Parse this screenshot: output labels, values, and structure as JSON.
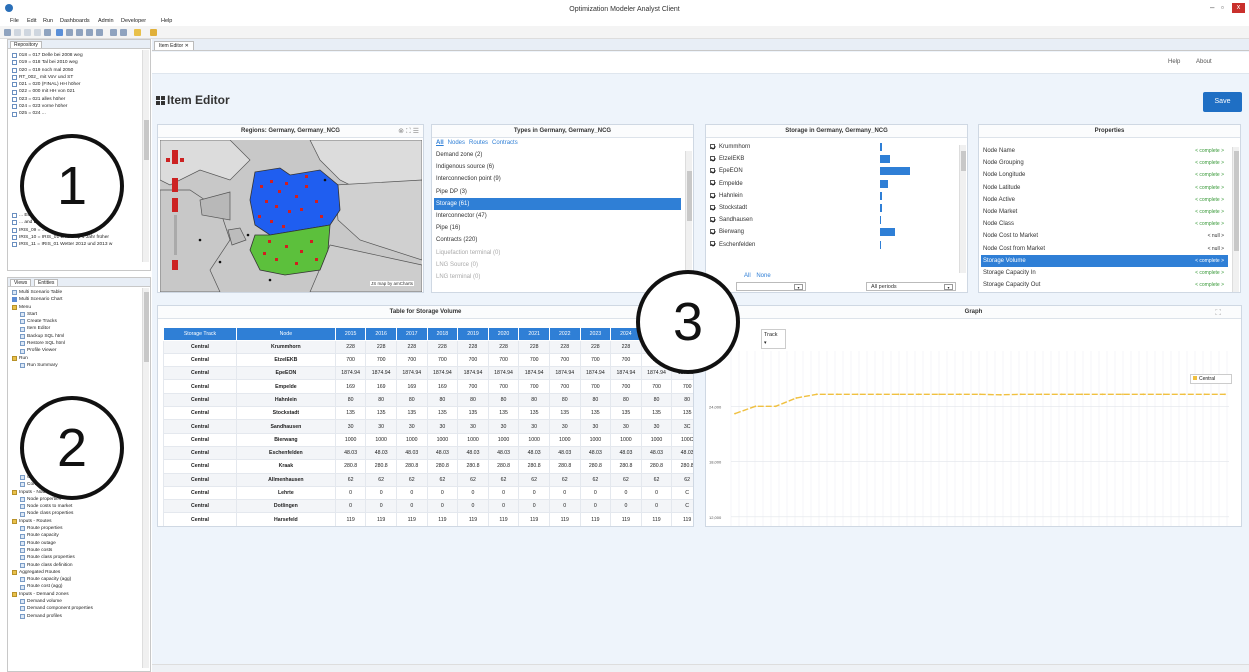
{
  "window": {
    "title": "Optimization Modeler Analyst Client",
    "minimize": "–",
    "restore": "▫",
    "close": "x"
  },
  "menu": [
    "File",
    "Edit",
    "Run",
    "Dashboards",
    "Admin",
    "Developer",
    "Help"
  ],
  "repository": {
    "tab_label": "Repository",
    "items": [
      "018 = 017 Delle bei 2008 weg",
      "019 = 018 Tal bei 2010 weg",
      "020 = 019 noch mal 2050",
      "RT_002_ mit VoV und ST",
      "021 = 020 (FINAL) HH höher",
      "022 = 000 mit HH von 021",
      "023 = 021 alles höher",
      "024 = 023 vorne höher",
      "025 = 024 ..."
    ],
    "items_lower": [
      "... Europ",
      "... and Europ",
      "IRIS_09 = ... Cap 1 Jahr später",
      "IRIS_10 = IRIS_01 LNG Cap 1 Jahr früher",
      "IRIS_11 = IRIS_01 Wetter 2012 und 2013 w"
    ]
  },
  "views": {
    "tab_views": "Views",
    "tab_entities": "Entities",
    "items_top": [
      {
        "label": "Multi Scenario Table",
        "icon": "page"
      },
      {
        "label": "Multi Scenario Chart",
        "icon": "chart"
      },
      {
        "label": "Menu",
        "icon": "folder"
      },
      {
        "label": "Start",
        "icon": "page",
        "indent": 1
      },
      {
        "label": "Create Tracks",
        "icon": "page",
        "indent": 1
      },
      {
        "label": "Item Editor",
        "icon": "page",
        "indent": 1
      },
      {
        "label": "Backup SQL html",
        "icon": "page",
        "indent": 1
      },
      {
        "label": "Restore SQL html",
        "icon": "page",
        "indent": 1
      },
      {
        "label": "Profile Viewer",
        "icon": "page",
        "indent": 1
      },
      {
        "label": "Run",
        "icon": "folder"
      },
      {
        "label": "Run Summary",
        "icon": "page",
        "indent": 1
      }
    ],
    "items_bottom": [
      {
        "label": "Cost ...",
        "icon": "page",
        "indent": 1
      },
      {
        "label": "Contract tracks",
        "icon": "page",
        "indent": 1
      },
      {
        "label": "Inputs - Nodes",
        "icon": "folder"
      },
      {
        "label": "Node properties",
        "icon": "page",
        "indent": 1
      },
      {
        "label": "Node costs to market",
        "icon": "page",
        "indent": 1
      },
      {
        "label": "Node class properties",
        "icon": "page",
        "indent": 1
      },
      {
        "label": "Inputs - Routes",
        "icon": "folder"
      },
      {
        "label": "Route properties",
        "icon": "page",
        "indent": 1
      },
      {
        "label": "Route capacity",
        "icon": "page",
        "indent": 1
      },
      {
        "label": "Route outage",
        "icon": "page",
        "indent": 1
      },
      {
        "label": "Route costs",
        "icon": "page",
        "indent": 1
      },
      {
        "label": "Route class properties",
        "icon": "page",
        "indent": 1
      },
      {
        "label": "Route class definition",
        "icon": "page",
        "indent": 1
      },
      {
        "label": "Aggregated Routes",
        "icon": "folder"
      },
      {
        "label": "Route capacity (agg)",
        "icon": "page",
        "indent": 1
      },
      {
        "label": "Route cost (agg)",
        "icon": "page",
        "indent": 1
      },
      {
        "label": "Inputs - Demand zones",
        "icon": "folder"
      },
      {
        "label": "Demand volume",
        "icon": "page",
        "indent": 1
      },
      {
        "label": "Demand component properties",
        "icon": "page",
        "indent": 1
      },
      {
        "label": "Demand profiles",
        "icon": "page",
        "indent": 1
      }
    ]
  },
  "editor": {
    "tab_label": "Item Editor",
    "help": "Help",
    "about": "About",
    "title": "Item Editor",
    "save": "Save"
  },
  "regions": {
    "title": "Regions: Germany, Germany_NCG",
    "credit": "JS map by amCharts"
  },
  "types": {
    "title": "Types in Germany, Germany_NCG",
    "filters": [
      "All",
      "Nodes",
      "Routes",
      "Contracts"
    ],
    "items": [
      {
        "label": "Demand zone (2)",
        "state": "normal"
      },
      {
        "label": "Indigenous source (6)",
        "state": "normal"
      },
      {
        "label": "Interconnection point (9)",
        "state": "normal"
      },
      {
        "label": "Pipe DP (3)",
        "state": "normal"
      },
      {
        "label": "Storage (61)",
        "state": "selected"
      },
      {
        "label": "Interconnector (47)",
        "state": "normal"
      },
      {
        "label": "Pipe (16)",
        "state": "normal"
      },
      {
        "label": "Contracts (220)",
        "state": "normal"
      },
      {
        "label": "Liquefaction terminal (0)",
        "state": "disabled"
      },
      {
        "label": "LNG Source (0)",
        "state": "disabled"
      },
      {
        "label": "LNG terminal (0)",
        "state": "disabled"
      }
    ]
  },
  "storage": {
    "title": "Storage in Germany, Germany_NCG",
    "items": [
      {
        "label": "Krummhorn",
        "fraction": 0.02
      },
      {
        "label": "EtzelEKB",
        "fraction": 0.13
      },
      {
        "label": "EpeEON",
        "fraction": 0.4
      },
      {
        "label": "Empelde",
        "fraction": 0.1
      },
      {
        "label": "Hahnlein",
        "fraction": 0.02
      },
      {
        "label": "Stockstadt",
        "fraction": 0.02
      },
      {
        "label": "Sandhausen",
        "fraction": 0.01
      },
      {
        "label": "Bierwang",
        "fraction": 0.2
      },
      {
        "label": "Eschenfelden",
        "fraction": 0.01
      }
    ],
    "select_all": "All",
    "select_none": "None",
    "period_select": "All periods"
  },
  "properties": {
    "title": "Properties",
    "items": [
      {
        "label": "Node Name",
        "value": "< complete >"
      },
      {
        "label": "Node Grouping",
        "value": "< complete >"
      },
      {
        "label": "Node Longitude",
        "value": "< complete >"
      },
      {
        "label": "Node Latitude",
        "value": "< complete >"
      },
      {
        "label": "Node Active",
        "value": "< complete >"
      },
      {
        "label": "Node Market",
        "value": "< complete >"
      },
      {
        "label": "Node Class",
        "value": "< complete >"
      },
      {
        "label": "Node Cost to Market",
        "value": "< null >"
      },
      {
        "label": "Node Cost from Market",
        "value": "< null >"
      },
      {
        "label": "Storage Volume",
        "value": "< complete >",
        "selected": true
      },
      {
        "label": "Storage Capacity In",
        "value": "< complete >"
      },
      {
        "label": "Storage Capacity Out",
        "value": "< complete >"
      }
    ]
  },
  "table": {
    "title": "Table for Storage Volume",
    "columns": [
      "Storage Track",
      "Node",
      "2015",
      "2016",
      "2017",
      "2018",
      "2019",
      "2020",
      "2021",
      "2022",
      "2023",
      "2024",
      "2025",
      "20"
    ],
    "rows": [
      [
        "Central",
        "Krummhorn",
        "228",
        "228",
        "228",
        "228",
        "228",
        "228",
        "228",
        "228",
        "228",
        "228",
        "228",
        ""
      ],
      [
        "Central",
        "EtzelEKB",
        "700",
        "700",
        "700",
        "700",
        "700",
        "700",
        "700",
        "700",
        "700",
        "700",
        "700",
        "7"
      ],
      [
        "Central",
        "EpeEON",
        "1874.94",
        "1874.94",
        "1874.94",
        "1874.94",
        "1874.94",
        "1874.94",
        "1874.94",
        "1874.94",
        "1874.94",
        "1874.94",
        "1874.94",
        "1874.94"
      ],
      [
        "Central",
        "Empelde",
        "169",
        "169",
        "169",
        "169",
        "700",
        "700",
        "700",
        "700",
        "700",
        "700",
        "700",
        "700"
      ],
      [
        "Central",
        "Hahnlein",
        "80",
        "80",
        "80",
        "80",
        "80",
        "80",
        "80",
        "80",
        "80",
        "80",
        "80",
        "80"
      ],
      [
        "Central",
        "Stockstadt",
        "135",
        "135",
        "135",
        "135",
        "135",
        "135",
        "135",
        "135",
        "135",
        "135",
        "135",
        "135"
      ],
      [
        "Central",
        "Sandhausen",
        "30",
        "30",
        "30",
        "30",
        "30",
        "30",
        "30",
        "30",
        "30",
        "30",
        "30",
        "3C"
      ],
      [
        "Central",
        "Bierwang",
        "1000",
        "1000",
        "1000",
        "1000",
        "1000",
        "1000",
        "1000",
        "1000",
        "1000",
        "1000",
        "1000",
        "100C"
      ],
      [
        "Central",
        "Eschenfelden",
        "48.03",
        "48.03",
        "48.03",
        "48.03",
        "48.03",
        "48.03",
        "48.03",
        "48.03",
        "48.03",
        "48.03",
        "48.03",
        "48.03"
      ],
      [
        "Central",
        "Kraak",
        "280.8",
        "280.8",
        "280.8",
        "280.8",
        "280.8",
        "280.8",
        "280.8",
        "280.8",
        "280.8",
        "280.8",
        "280.8",
        "280.8"
      ],
      [
        "Central",
        "Allmenhausen",
        "62",
        "62",
        "62",
        "62",
        "62",
        "62",
        "62",
        "62",
        "62",
        "62",
        "62",
        "62"
      ],
      [
        "Central",
        "Lehrte",
        "0",
        "0",
        "0",
        "0",
        "0",
        "0",
        "0",
        "0",
        "0",
        "0",
        "0",
        "C"
      ],
      [
        "Central",
        "Dotlingen",
        "0",
        "0",
        "0",
        "0",
        "0",
        "0",
        "0",
        "0",
        "0",
        "0",
        "0",
        "C"
      ],
      [
        "Central",
        "Harsefeld",
        "119",
        "119",
        "119",
        "119",
        "119",
        "119",
        "119",
        "119",
        "119",
        "119",
        "119",
        "119"
      ]
    ]
  },
  "graph": {
    "title": "Graph",
    "track_label": "Track",
    "legend": "Central",
    "yticks": [
      "24,000",
      "18,000",
      "12,000"
    ]
  },
  "annotations": [
    "1",
    "2",
    "3"
  ],
  "chart_data": {
    "type": "line",
    "title": "Graph",
    "series": [
      {
        "name": "Central",
        "values": [
          23200,
          24000,
          24000,
          24900,
          25300,
          25300,
          25300,
          25300,
          25300,
          25300,
          25300,
          25300,
          25300,
          25250,
          25300,
          25300,
          25300,
          25300,
          25300,
          25300,
          25300,
          25300,
          25300,
          25300,
          25300
        ]
      }
    ],
    "yticks": [
      24000,
      18000,
      12000
    ],
    "legend": "top-right",
    "color": "#f0c040"
  }
}
